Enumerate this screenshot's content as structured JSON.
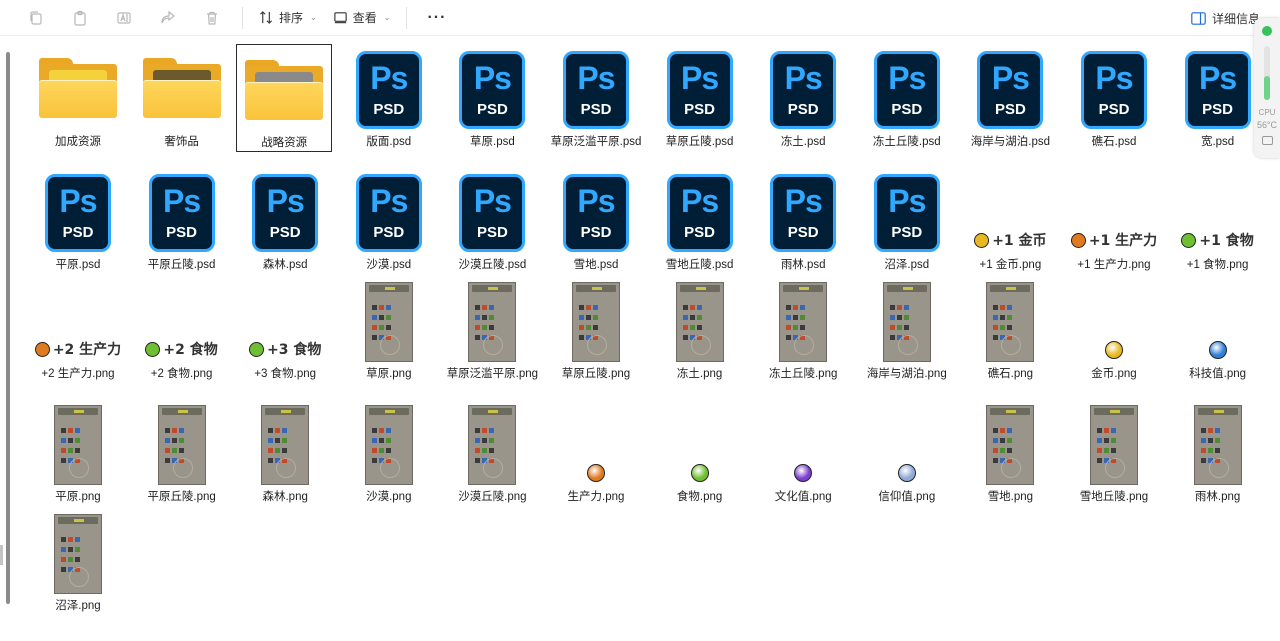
{
  "toolbar": {
    "sort_label": "排序",
    "view_label": "查看",
    "more_label": "···",
    "details_label": "详细信息"
  },
  "monitor": {
    "cpu_label": "CPU",
    "temp": "56°C",
    "cpu_level": 0.45
  },
  "items": [
    {
      "label": "加成资源",
      "kind": "folder",
      "content": "bananas",
      "color": "#f4d23b"
    },
    {
      "label": "奢饰品",
      "kind": "folder",
      "content": "turtle",
      "color": "#6a5a2c"
    },
    {
      "label": "战略资源",
      "kind": "folder",
      "content": "metal",
      "color": "#8a8a8a",
      "selected": true
    },
    {
      "label": "版面.psd",
      "kind": "psd"
    },
    {
      "label": "草原.psd",
      "kind": "psd"
    },
    {
      "label": "草原泛滥平原.psd",
      "kind": "psd"
    },
    {
      "label": "草原丘陵.psd",
      "kind": "psd"
    },
    {
      "label": "冻土.psd",
      "kind": "psd"
    },
    {
      "label": "冻土丘陵.psd",
      "kind": "psd"
    },
    {
      "label": "海岸与湖泊.psd",
      "kind": "psd"
    },
    {
      "label": "礁石.psd",
      "kind": "psd"
    },
    {
      "label": "宽.psd",
      "kind": "psd"
    },
    {
      "label": "平原.psd",
      "kind": "psd"
    },
    {
      "label": "平原丘陵.psd",
      "kind": "psd"
    },
    {
      "label": "森林.psd",
      "kind": "psd"
    },
    {
      "label": "沙漠.psd",
      "kind": "psd"
    },
    {
      "label": "沙漠丘陵.psd",
      "kind": "psd"
    },
    {
      "label": "雪地.psd",
      "kind": "psd"
    },
    {
      "label": "雪地丘陵.psd",
      "kind": "psd"
    },
    {
      "label": "雨林.psd",
      "kind": "psd"
    },
    {
      "label": "沼泽.psd",
      "kind": "psd"
    },
    {
      "label": "+1 金币.png",
      "kind": "badge",
      "badge_text": "+1 金币",
      "icon_color": "#e8b820"
    },
    {
      "label": "+1 生产力.png",
      "kind": "badge",
      "badge_text": "+1 生产力",
      "icon_color": "#e07a1e"
    },
    {
      "label": "+1 食物.png",
      "kind": "badge",
      "badge_text": "+1 食物",
      "icon_color": "#6fbf32"
    },
    {
      "label": "+2 生产力.png",
      "kind": "badge",
      "badge_text": "+2 生产力",
      "icon_color": "#e07a1e"
    },
    {
      "label": "+2 食物.png",
      "kind": "badge",
      "badge_text": "+2 食物",
      "icon_color": "#6fbf32"
    },
    {
      "label": "+3 食物.png",
      "kind": "badge",
      "badge_text": "+3 食物",
      "icon_color": "#6fbf32"
    },
    {
      "label": "草原.png",
      "kind": "shot"
    },
    {
      "label": "草原泛滥平原.png",
      "kind": "shot"
    },
    {
      "label": "草原丘陵.png",
      "kind": "shot"
    },
    {
      "label": "冻土.png",
      "kind": "shot"
    },
    {
      "label": "冻土丘陵.png",
      "kind": "shot"
    },
    {
      "label": "海岸与湖泊.png",
      "kind": "shot"
    },
    {
      "label": "礁石.png",
      "kind": "shot"
    },
    {
      "label": "金币.png",
      "kind": "icon",
      "icon_color": "#e8b820"
    },
    {
      "label": "科技值.png",
      "kind": "icon",
      "icon_color": "#2f7fd8"
    },
    {
      "label": "平原.png",
      "kind": "shot"
    },
    {
      "label": "平原丘陵.png",
      "kind": "shot"
    },
    {
      "label": "森林.png",
      "kind": "shot"
    },
    {
      "label": "沙漠.png",
      "kind": "shot"
    },
    {
      "label": "沙漠丘陵.png",
      "kind": "shot"
    },
    {
      "label": "生产力.png",
      "kind": "icon",
      "icon_color": "#e07a1e"
    },
    {
      "label": "食物.png",
      "kind": "icon",
      "icon_color": "#6fbf32"
    },
    {
      "label": "文化值.png",
      "kind": "icon",
      "icon_color": "#7b3fd0"
    },
    {
      "label": "信仰值.png",
      "kind": "icon",
      "icon_color": "#8fa9d8"
    },
    {
      "label": "雪地.png",
      "kind": "shot"
    },
    {
      "label": "雪地丘陵.png",
      "kind": "shot"
    },
    {
      "label": "雨林.png",
      "kind": "shot"
    },
    {
      "label": "沼泽.png",
      "kind": "shot"
    }
  ]
}
